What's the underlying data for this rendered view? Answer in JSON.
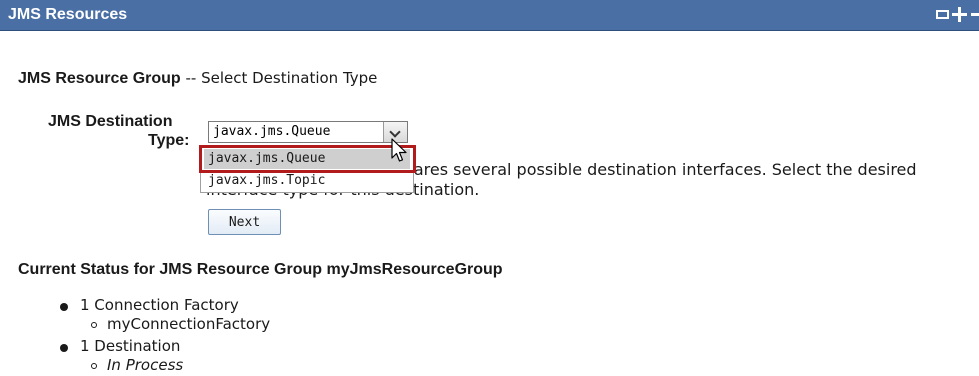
{
  "header": {
    "title": "JMS Resources",
    "controls": [
      {
        "name": "maximize-icon"
      },
      {
        "name": "plus-icon"
      },
      {
        "name": "minus-icon"
      }
    ]
  },
  "wizard": {
    "subtitle_bold": "JMS Resource Group",
    "subtitle_rest": " -- Select Destination Type",
    "dest_label_line1": "JMS Destination",
    "dest_label_line2": "Type:",
    "select_value": "javax.jms.Queue",
    "options": [
      "javax.jms.Queue",
      "javax.jms.Topic"
    ],
    "description": "The JMS specification declares several possible destination interfaces. Select the desired interface type for this destination.",
    "next_label": "Next"
  },
  "status": {
    "title": "Current Status for JMS Resource Group myJmsResourceGroup",
    "items": [
      {
        "label": "1 Connection Factory",
        "sub": "myConnectionFactory"
      },
      {
        "label": "1 Destination",
        "sub": "In Process"
      }
    ]
  },
  "colors": {
    "header_bg": "#4a6fa5",
    "highlight_border": "#b21b1b"
  }
}
